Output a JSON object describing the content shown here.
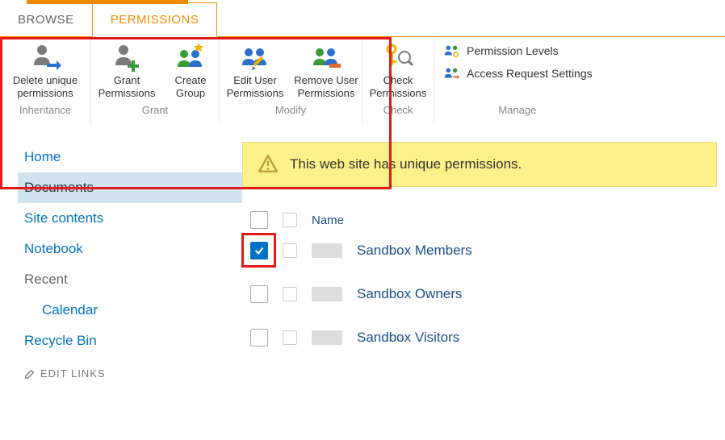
{
  "tabs": {
    "browse": "BROWSE",
    "permissions": "PERMISSIONS"
  },
  "ribbon": {
    "inheritance": {
      "label": "Inheritance",
      "delete_unique": "Delete unique permissions"
    },
    "grant": {
      "label": "Grant",
      "grant_permissions": "Grant Permissions",
      "create_group": "Create Group"
    },
    "modify": {
      "label": "Modify",
      "edit_user": "Edit User Permissions",
      "remove_user": "Remove User Permissions"
    },
    "check": {
      "label": "Check",
      "check_permissions": "Check Permissions"
    },
    "manage": {
      "label": "Manage",
      "permission_levels": "Permission Levels",
      "access_request": "Access Request Settings"
    }
  },
  "sidebar": {
    "home": "Home",
    "documents": "Documents",
    "site_contents": "Site contents",
    "notebook": "Notebook",
    "recent": "Recent",
    "calendar": "Calendar",
    "recycle": "Recycle Bin",
    "edit_links": "EDIT LINKS"
  },
  "alert_text": "This web site has unique permissions.",
  "table": {
    "name_header": "Name",
    "rows": [
      {
        "name": "Sandbox Members",
        "checked": true
      },
      {
        "name": "Sandbox Owners",
        "checked": false
      },
      {
        "name": "Sandbox Visitors",
        "checked": false
      }
    ]
  }
}
